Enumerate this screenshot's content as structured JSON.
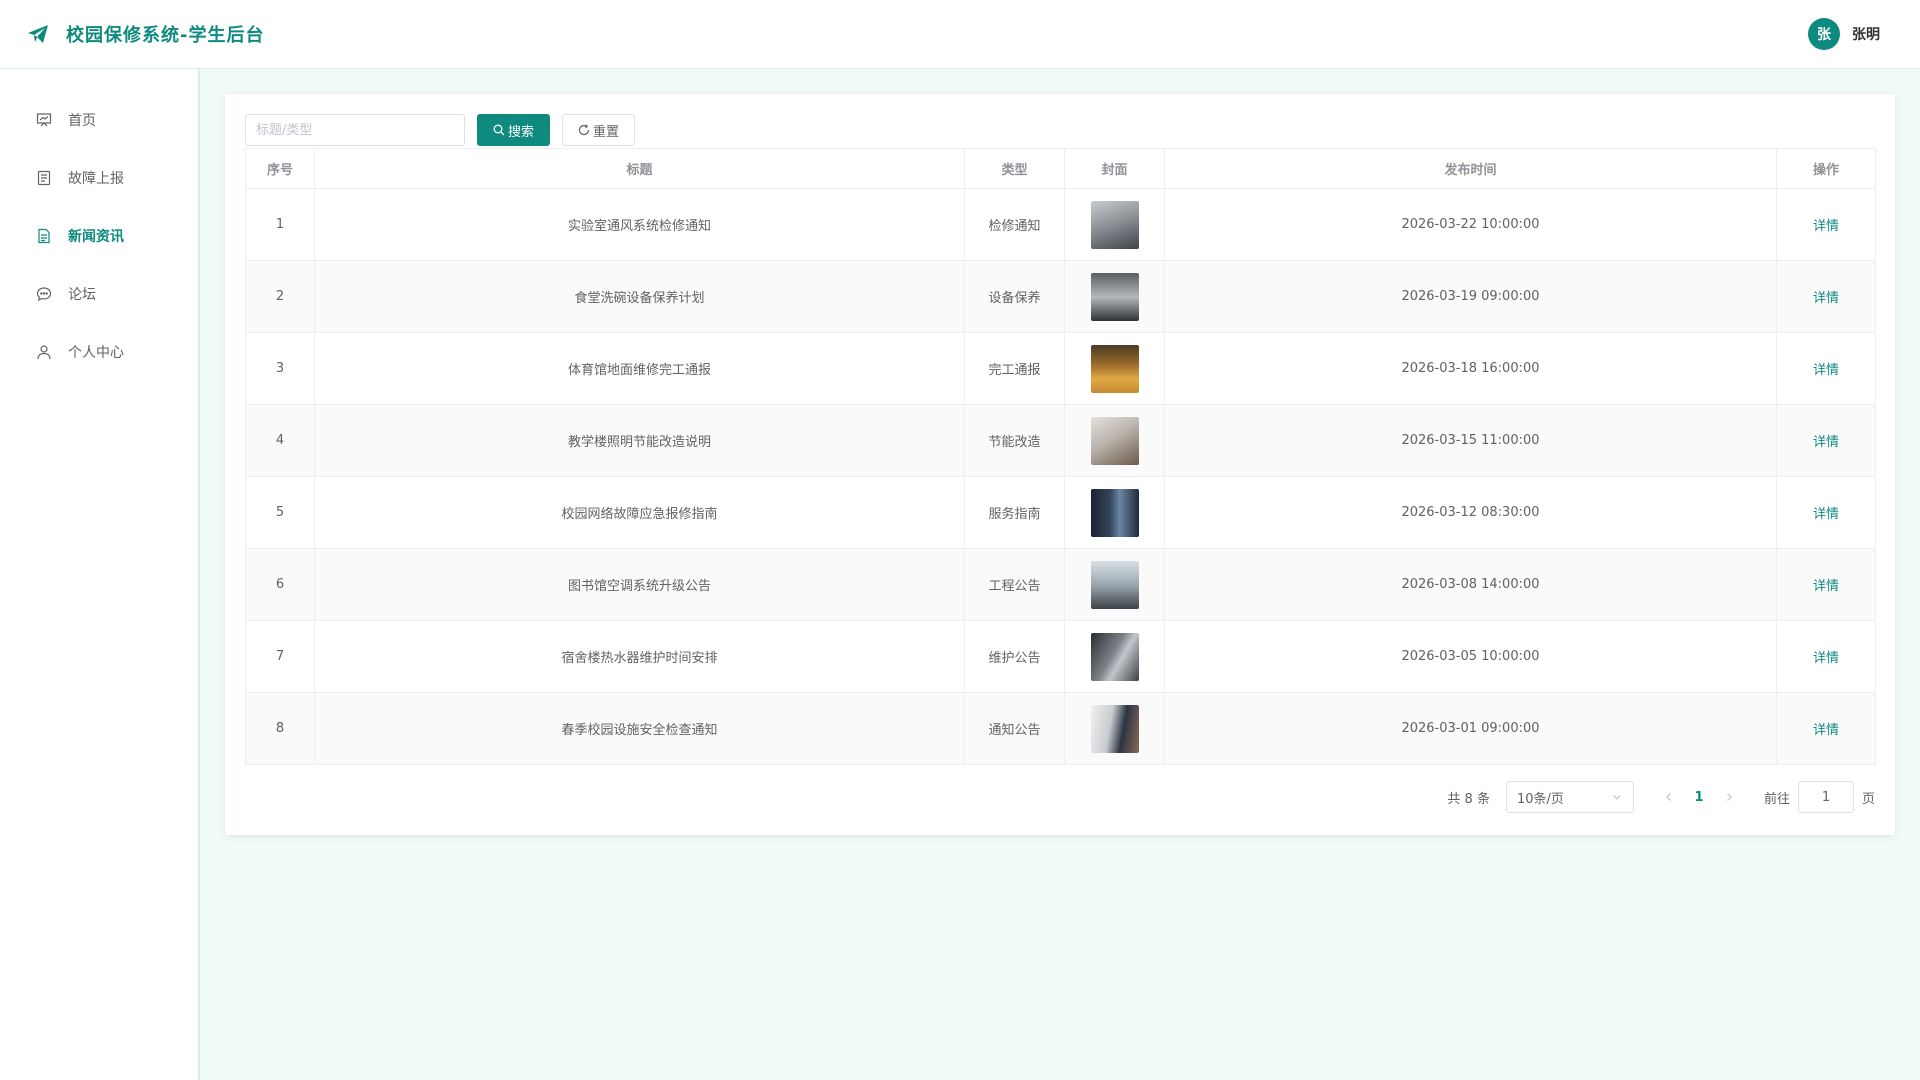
{
  "header": {
    "title": "校园保修系统-学生后台",
    "avatar_text": "张",
    "username": "张明"
  },
  "sidebar": {
    "items": [
      {
        "label": "首页",
        "icon": "easel-icon"
      },
      {
        "label": "故障上报",
        "icon": "document-icon"
      },
      {
        "label": "新闻资讯",
        "icon": "document-icon",
        "active": true
      },
      {
        "label": "论坛",
        "icon": "chat-bubble-icon"
      },
      {
        "label": "个人中心",
        "icon": "user-icon"
      }
    ]
  },
  "toolbar": {
    "search_placeholder": "标题/类型",
    "search_label": "搜索",
    "reset_label": "重置"
  },
  "table": {
    "headers": [
      "序号",
      "标题",
      "类型",
      "封面",
      "发布时间",
      "操作"
    ],
    "action_label": "详情",
    "rows": [
      {
        "no": "1",
        "title": "实验室通风系统检修通知",
        "type": "检修通知",
        "time": "2026-03-22 10:00:00"
      },
      {
        "no": "2",
        "title": "食堂洗碗设备保养计划",
        "type": "设备保养",
        "time": "2026-03-19 09:00:00"
      },
      {
        "no": "3",
        "title": "体育馆地面维修完工通报",
        "type": "完工通报",
        "time": "2026-03-18 16:00:00"
      },
      {
        "no": "4",
        "title": "教学楼照明节能改造说明",
        "type": "节能改造",
        "time": "2026-03-15 11:00:00"
      },
      {
        "no": "5",
        "title": "校园网络故障应急报修指南",
        "type": "服务指南",
        "time": "2026-03-12 08:30:00"
      },
      {
        "no": "6",
        "title": "图书馆空调系统升级公告",
        "type": "工程公告",
        "time": "2026-03-08 14:00:00"
      },
      {
        "no": "7",
        "title": "宿舍楼热水器维护时间安排",
        "type": "维护公告",
        "time": "2026-03-05 10:00:00"
      },
      {
        "no": "8",
        "title": "春季校园设施安全检查通知",
        "type": "通知公告",
        "time": "2026-03-01 09:00:00"
      }
    ]
  },
  "pagination": {
    "total": "共 8 条",
    "page_size": "10条/页",
    "current": "1",
    "goto_label": "前往",
    "goto_value": "1",
    "page_unit": "页"
  },
  "colors": {
    "accent": "#0f8a7e",
    "background": "#f0faf8"
  }
}
